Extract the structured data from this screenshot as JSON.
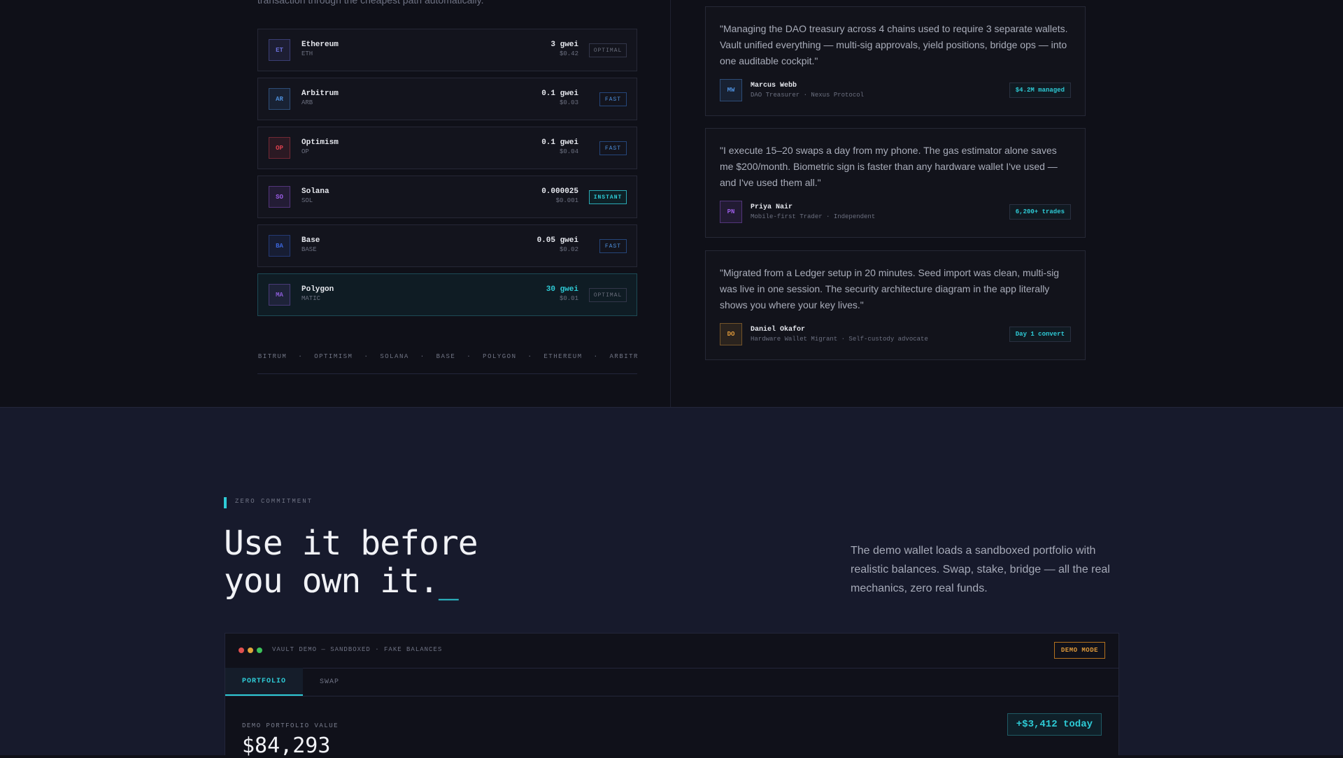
{
  "gas_section": {
    "intro_cutoff": "transaction through the cheapest path automatically.",
    "chains": [
      {
        "badge": "ET",
        "name": "Ethereum",
        "symbol": "ETH",
        "gas": "3 gwei",
        "usd": "$0.42",
        "speed": "OPTIMAL",
        "badge_color": "#6a6fd8",
        "active": false
      },
      {
        "badge": "AR",
        "name": "Arbitrum",
        "symbol": "ARB",
        "gas": "0.1 gwei",
        "usd": "$0.03",
        "speed": "FAST",
        "badge_color": "#4d8fdc",
        "active": false
      },
      {
        "badge": "OP",
        "name": "Optimism",
        "symbol": "OP",
        "gas": "0.1 gwei",
        "usd": "$0.04",
        "speed": "FAST",
        "badge_color": "#e0414f",
        "active": false
      },
      {
        "badge": "SO",
        "name": "Solana",
        "symbol": "SOL",
        "gas": "0.000025",
        "usd": "$0.001",
        "speed": "INSTANT",
        "badge_color": "#9b5ce6",
        "active": false
      },
      {
        "badge": "BA",
        "name": "Base",
        "symbol": "BASE",
        "gas": "0.05 gwei",
        "usd": "$0.02",
        "speed": "FAST",
        "badge_color": "#3a64d8",
        "active": false
      },
      {
        "badge": "MA",
        "name": "Polygon",
        "symbol": "MATIC",
        "gas": "30 gwei",
        "usd": "$0.01",
        "speed": "OPTIMAL",
        "badge_color": "#8a5cd6",
        "active": true
      }
    ],
    "ticker": [
      "RBITRUM",
      "OPTIMISM",
      "SOLANA",
      "BASE",
      "POLYGON",
      "ETHEREUM",
      "ARBITRUM"
    ],
    "ticker_sep": "·"
  },
  "testimonials": [
    {
      "quote": "\"Managing the DAO treasury across 4 chains used to require 3 separate wallets. Vault unified everything — multi-sig approvals, yield positions, bridge ops — into one auditable cockpit.\"",
      "initials": "MW",
      "name": "Marcus Webb",
      "role": "DAO Treasurer · Nexus Protocol",
      "badge": "$4.2M managed",
      "avatar_color": "#4d8fdc"
    },
    {
      "quote": "\"I execute 15–20 swaps a day from my phone. The gas estimator alone saves me $200/month. Biometric sign is faster than any hardware wallet I've used — and I've used them all.\"",
      "initials": "PN",
      "name": "Priya Nair",
      "role": "Mobile-first Trader · Independent",
      "badge": "6,200+ trades",
      "avatar_color": "#9b5ce6"
    },
    {
      "quote": "\"Migrated from a Ledger setup in 20 minutes. Seed import was clean, multi-sig was live in one session. The security architecture diagram in the app literally shows you where your key lives.\"",
      "initials": "DO",
      "name": "Daniel Okafor",
      "role": "Hardware Wallet Migrant · Self-custody advocate",
      "badge": "Day 1 convert",
      "avatar_color": "#e09a3a"
    }
  ],
  "demo_section": {
    "eyebrow": "ZERO COMMITMENT",
    "headline_line1": "Use it before",
    "headline_line2": "you own it.",
    "cursor": "_",
    "description": "The demo wallet loads a sandboxed portfolio with realistic balances. Swap, stake, bridge — all the real mechanics, zero real funds.",
    "window": {
      "title": "VAULT DEMO — SANDBOXED · FAKE BALANCES",
      "mode_badge": "DEMO MODE",
      "tabs": [
        "PORTFOLIO",
        "SWAP"
      ],
      "portfolio_label": "DEMO PORTFOLIO VALUE",
      "portfolio_value": "$84,293",
      "today_change": "+$3,412 today"
    }
  }
}
